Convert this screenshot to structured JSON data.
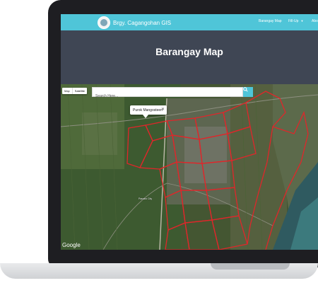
{
  "app": {
    "brand_name": "Brgy. Cagangohan GIS",
    "logo_icon": "barangay-seal-icon",
    "accent_color": "#4fc5d8",
    "header_bg": "#3f4654"
  },
  "nav": {
    "items": [
      {
        "label": "Barangay Map"
      },
      {
        "label": "Fill-Up",
        "dropdown_icon": "caret-down-icon"
      },
      {
        "label": "Abo"
      }
    ]
  },
  "page": {
    "title": "Barangay Map"
  },
  "map": {
    "map_type": {
      "map_label": "Map",
      "satellite_label": "Satellite"
    },
    "search": {
      "placeholder": "Search Here...",
      "icon": "search-icon"
    },
    "info_window": {
      "text": "Purok Mangosteen",
      "close_icon": "close-icon"
    },
    "place_labels": [
      "Panabo City"
    ],
    "google_label": "Google",
    "boundary_color": "#e0262a"
  }
}
